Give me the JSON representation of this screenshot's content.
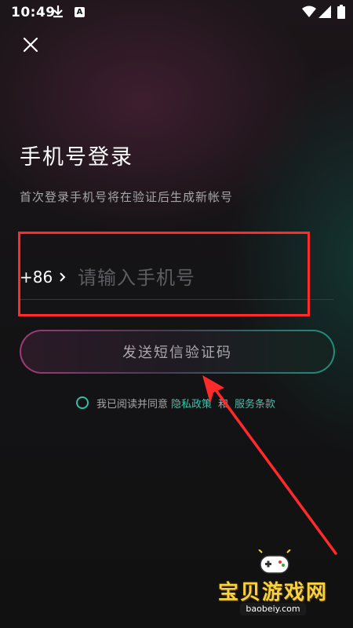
{
  "status_bar": {
    "time": "10:49",
    "notification_badge": "A"
  },
  "header": {
    "close_icon": "close-icon"
  },
  "login": {
    "title": "手机号登录",
    "subtitle": "首次登录手机号将在验证后生成新帐号",
    "country_code": "+86",
    "phone_placeholder": "请输入手机号",
    "phone_value": "",
    "send_code_label": "发送短信验证码"
  },
  "agreement": {
    "prefix": "我已阅读并同意",
    "privacy_link": "隐私政策",
    "and": "和",
    "terms_link": "服务条款",
    "checked": false
  },
  "watermark": {
    "brand": "宝贝游戏网",
    "url": "baobeiy.com"
  },
  "colors": {
    "accent_green": "#36c7ae",
    "annotation_red": "#ff2a2a",
    "watermark_yellow": "#f7d23e"
  }
}
